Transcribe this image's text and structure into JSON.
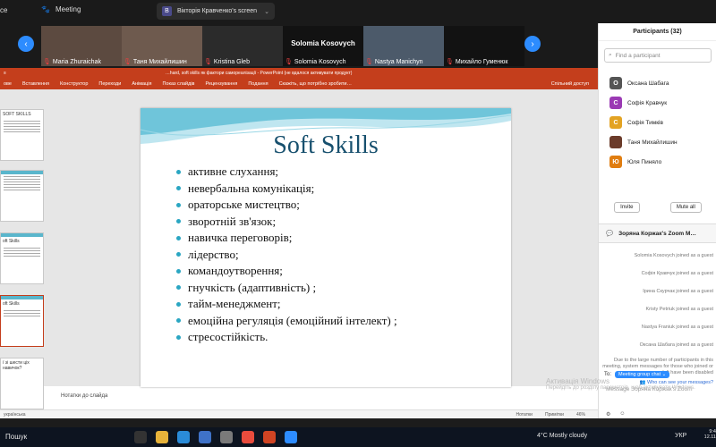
{
  "zoom": {
    "left_label": "ce",
    "meeting_label": "Meeting",
    "share_initial": "В",
    "share_label": "Вікторія Кравченко's screen"
  },
  "strip": {
    "prev": "‹",
    "next": "›",
    "tiles": [
      {
        "name": "Maria Zhuraichak"
      },
      {
        "name": "Таня Михайлишин"
      },
      {
        "name": "Kristina Gleb"
      },
      {
        "name": "Solomia Kosovych",
        "big": "Solomia Kosovych"
      },
      {
        "name": "Nastya Manichyn"
      },
      {
        "name": "Михайло Гуменюк"
      }
    ]
  },
  "ppt": {
    "title": "…hard, soft skills як фактори самореалізації - PowerPoint (не вдалося активувати продукт)",
    "tabs": [
      "ове",
      "Вставлення",
      "Конструктор",
      "Переходи",
      "Анімація",
      "Показ слайдів",
      "Рецензування",
      "Подання"
    ],
    "tell_me": "Скажіть, що потрібно зробити…",
    "share": "Спільний доступ",
    "thumb_titles": [
      "SOFT SKILLS",
      "",
      "oft Skills",
      "oft Skills",
      "ї зі шести ціх навичок?"
    ],
    "slide_title": "Soft Skills",
    "bullets": [
      "активне слухання;",
      "невербальна комунікація;",
      "ораторське мистецтво;",
      "зворотній зв'язок;",
      "навичка переговорів;",
      "лідерство;",
      "командоутворення;",
      "гнучкість (адаптивність) ;",
      "тайм-менеджмент;",
      "емоційна регуляція (емоційний інтелект) ;",
      "стресостійкість."
    ],
    "notes": "Нотатки до слайда",
    "status_lang": "українська",
    "status_notes": "Нотатки",
    "status_comments": "Примітки",
    "zoom_level": "46%"
  },
  "participants": {
    "header": "Participants (32)",
    "find_placeholder": "Find a participant",
    "list": [
      {
        "initial": "О",
        "name": "Оксана Шабага",
        "color": "#555555"
      },
      {
        "initial": "С",
        "name": "Софія Кравчук",
        "color": "#9b3ab4"
      },
      {
        "initial": "С",
        "name": "Софія Тимків",
        "color": "#e3a323"
      },
      {
        "initial": "",
        "name": "Таня Михайлишин",
        "color": "#6b3b2a"
      },
      {
        "initial": "Ю",
        "name": "Юля Пиняло",
        "color": "#e07d10"
      }
    ],
    "invite": "Invite",
    "mute_all": "Mute all"
  },
  "chat": {
    "header": "Зоряна Коржак's Zoom M…",
    "messages": [
      "Solomia Kosovych joined as a guest",
      "Софія Кравчук joined as a guest",
      "Ірина Скурчак joined as a guest",
      "Kristy Petriuk joined as a guest",
      "Nastya Franiuk joined as a guest",
      "Оксана Шабага joined as a guest"
    ],
    "system_note": "Due to the large number of participants in this meeting, system messages for those who joined or left have been disabled",
    "who_can_see": "Who can see your messages?",
    "to_label": "To:",
    "to_value": "Meeting group chat ⌄",
    "input_placeholder": "Message Зоряна Коржак's Zoom",
    "foot_icons": [
      "⚙",
      "☺"
    ]
  },
  "watermark": {
    "line1": "Активація Windows",
    "line2": "Перейдіть до розділу параметрів, щоб активувати Windows."
  },
  "taskbar": {
    "search": "Пошук",
    "weather": "4°C  Mostly cloudy",
    "lang": "УКР",
    "time": "9:4",
    "date": "12.11"
  }
}
